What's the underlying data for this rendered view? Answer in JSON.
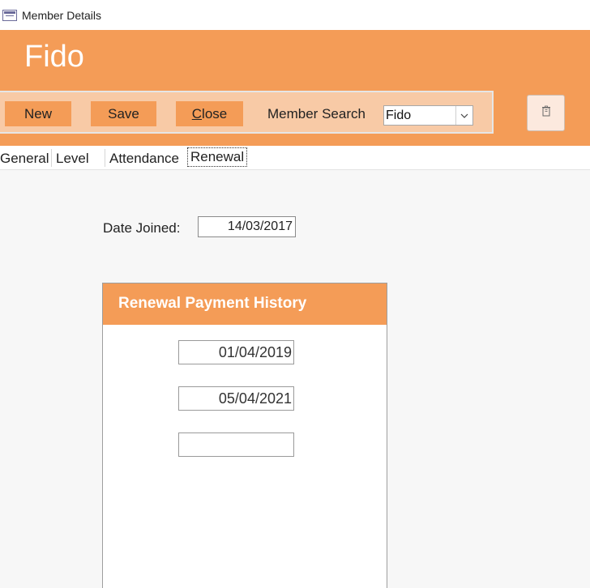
{
  "window": {
    "title": "Member Details"
  },
  "header": {
    "record_title": "Fido"
  },
  "toolbar": {
    "new_label": "New",
    "save_label": "Save",
    "close_prefix": "C",
    "close_rest": "lose",
    "search_label": "Member Search",
    "search_value": "Fido"
  },
  "tabs": [
    {
      "label": "General"
    },
    {
      "label": "Level"
    },
    {
      "label": "Attendance"
    },
    {
      "label": "Renewal",
      "active": true
    }
  ],
  "form": {
    "date_joined_label": "Date Joined:",
    "date_joined_value": "14/03/2017"
  },
  "renewal": {
    "title": "Renewal Payment History",
    "payments": [
      "01/04/2019",
      "05/04/2021",
      ""
    ]
  },
  "colors": {
    "accent": "#f49c57",
    "toolbar_bg": "#f8caa6",
    "panel_bg": "#ffffff",
    "page_bg": "#f7f7f7"
  },
  "icons": {
    "app": "form-window-icon",
    "delete": "trash-icon",
    "dropdown": "chevron-down-icon"
  }
}
